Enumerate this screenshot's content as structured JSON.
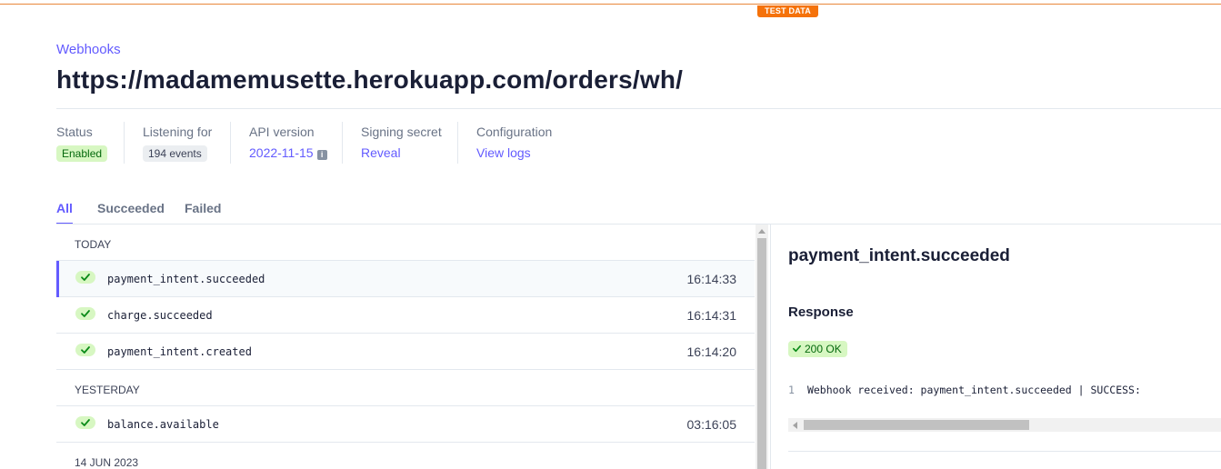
{
  "banner": {
    "test_data": "TEST DATA"
  },
  "breadcrumb": "Webhooks",
  "title": "https://madamemusette.herokuapp.com/orders/wh/",
  "meta": {
    "status": {
      "label": "Status",
      "value": "Enabled"
    },
    "listening": {
      "label": "Listening for",
      "value": "194 events"
    },
    "api": {
      "label": "API version",
      "value": "2022-11-15",
      "icon": "info-icon"
    },
    "secret": {
      "label": "Signing secret",
      "value": "Reveal"
    },
    "config": {
      "label": "Configuration",
      "value": "View logs"
    }
  },
  "tabs": [
    {
      "label": "All",
      "active": true
    },
    {
      "label": "Succeeded",
      "active": false
    },
    {
      "label": "Failed",
      "active": false
    }
  ],
  "events": {
    "group_today": "TODAY",
    "group_yesterday": "YESTERDAY",
    "group_older": "14 JUN 2023",
    "rows": [
      {
        "name": "payment_intent.succeeded",
        "time": "16:14:33",
        "status": "check-icon"
      },
      {
        "name": "charge.succeeded",
        "time": "16:14:31",
        "status": "check-icon"
      },
      {
        "name": "payment_intent.created",
        "time": "16:14:20",
        "status": "check-icon"
      },
      {
        "name": "balance.available",
        "time": "03:16:05",
        "status": "check-icon"
      }
    ]
  },
  "detail": {
    "event_name": "payment_intent.succeeded",
    "response_heading": "Response",
    "status": "200 OK",
    "body_line_number": "1",
    "body": "Webhook received: payment_intent.succeeded | SUCCESS:"
  },
  "colors": {
    "accent": "#635bff",
    "success_bg": "#d7f7c2",
    "success_fg": "#05690d",
    "test_badge": "#f5720a"
  }
}
